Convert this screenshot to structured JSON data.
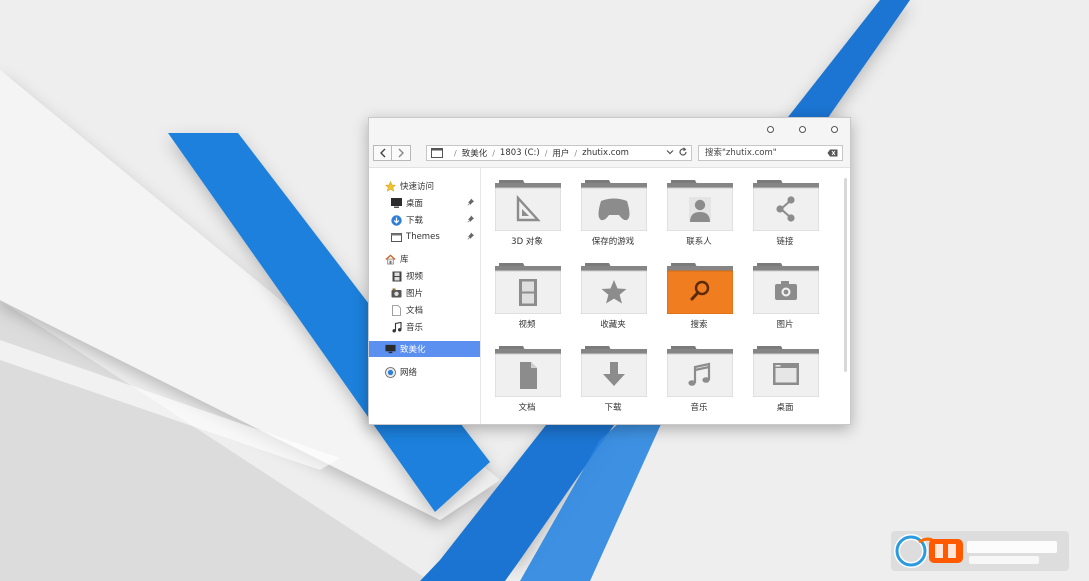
{
  "colors": {
    "accent_blue": "#1f7ddc",
    "selection": "#5b8ff0",
    "search_folder": "#f07d1f"
  },
  "titlebar": {
    "controls": [
      "minimize-icon",
      "maximize-icon",
      "close-icon"
    ]
  },
  "address_bar": {
    "crumbs": [
      {
        "label": "致美化"
      },
      {
        "label": "1803 (C:)"
      },
      {
        "label": "用户"
      },
      {
        "label": "zhutix.com"
      }
    ]
  },
  "search_box": {
    "value": "搜索\"zhutix.com\""
  },
  "sidebar": {
    "items": [
      {
        "label": "快速访问",
        "icon": "star-icon",
        "level": 0
      },
      {
        "label": "桌面",
        "icon": "desktop-icon",
        "level": 1,
        "pinned": true
      },
      {
        "label": "下载",
        "icon": "download-icon",
        "level": 1,
        "pinned": true
      },
      {
        "label": "Themes",
        "icon": "folder-icon",
        "level": 1,
        "pinned": true
      },
      {
        "label": "库",
        "icon": "house-icon",
        "level": 0
      },
      {
        "label": "视频",
        "icon": "film-icon",
        "level": 1
      },
      {
        "label": "图片",
        "icon": "picture-icon",
        "level": 1
      },
      {
        "label": "文档",
        "icon": "document-icon",
        "level": 1
      },
      {
        "label": "音乐",
        "icon": "music-note-icon",
        "level": 1
      },
      {
        "label": "致美化",
        "icon": "monitor-icon",
        "level": 0,
        "selected": true
      },
      {
        "label": "网络",
        "icon": "network-icon",
        "level": 0
      }
    ]
  },
  "folders": [
    {
      "label": "3D 对象",
      "icon": "triangle-ruler-icon"
    },
    {
      "label": "保存的游戏",
      "icon": "gamepad-icon"
    },
    {
      "label": "联系人",
      "icon": "person-icon"
    },
    {
      "label": "链接",
      "icon": "share-icon"
    },
    {
      "label": "视频",
      "icon": "film-icon"
    },
    {
      "label": "收藏夹",
      "icon": "star-icon"
    },
    {
      "label": "搜索",
      "icon": "magnifier-icon",
      "highlight": true
    },
    {
      "label": "图片",
      "icon": "camera-icon"
    },
    {
      "label": "文档",
      "icon": "document-icon"
    },
    {
      "label": "下载",
      "icon": "download-arrow-icon"
    },
    {
      "label": "音乐",
      "icon": "music-note-icon"
    },
    {
      "label": "桌面",
      "icon": "desktop-window-icon"
    }
  ]
}
